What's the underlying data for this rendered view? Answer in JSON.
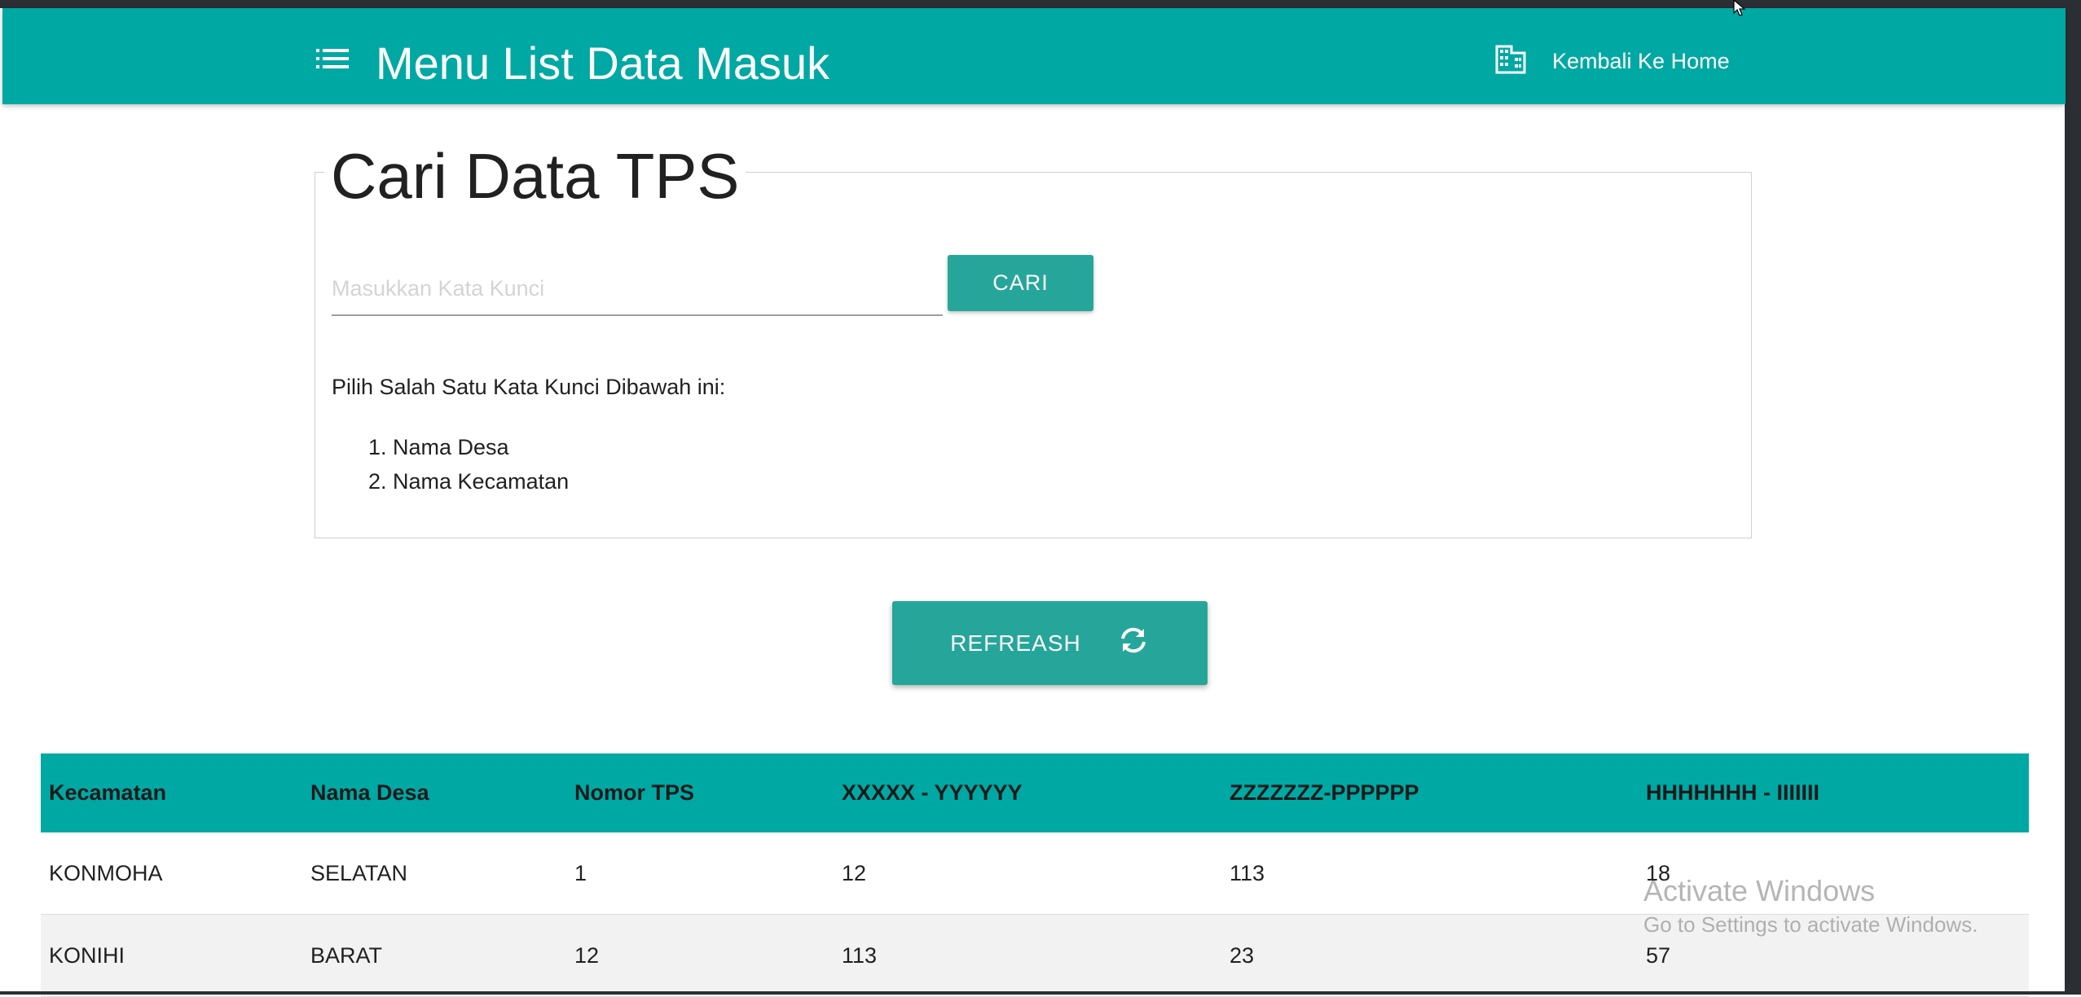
{
  "navbar": {
    "title": "Menu List Data Masuk",
    "home_label": "Kembali Ke Home",
    "accent_color": "#00a8a4",
    "menu_icon": "menu-icon",
    "home_icon": "building-icon"
  },
  "search": {
    "title": "Cari Data TPS",
    "placeholder": "Masukkan Kata Kunci",
    "value": "",
    "button_label": "CARI",
    "instruction": "Pilih Salah Satu Kata Kunci Dibawah ini:",
    "options": [
      "1. Nama Desa",
      "2. Nama Kecamatan"
    ]
  },
  "refresh": {
    "label": "REFREASH",
    "icon": "refresh-icon"
  },
  "table": {
    "headers": [
      "Kecamatan",
      "Nama Desa",
      "Nomor TPS",
      "XXXXX - YYYYYY",
      "ZZZZZZZ-PPPPPP",
      "HHHHHHH - IIIIIII"
    ],
    "rows": [
      [
        "KONMOHA",
        "SELATAN",
        "1",
        "12",
        "113",
        "18"
      ],
      [
        "KONIHI",
        "BARAT",
        "12",
        "113",
        "23",
        "57"
      ]
    ]
  },
  "watermark": {
    "title": "Activate Windows",
    "subtitle": "Go to Settings to activate Windows."
  }
}
